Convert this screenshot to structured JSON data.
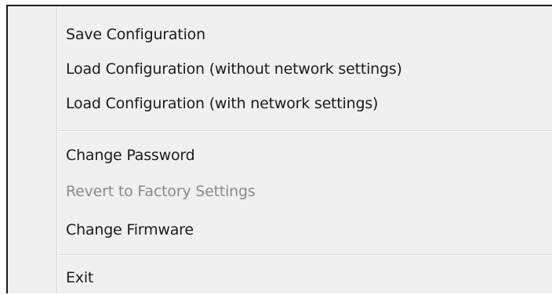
{
  "menu": {
    "items": [
      {
        "label": "Save Configuration",
        "enabled": true
      },
      {
        "label": "Load Configuration (without network settings)",
        "enabled": true
      },
      {
        "label": "Load Configuration (with network settings)",
        "enabled": true
      },
      {
        "label": "Change Password",
        "enabled": true
      },
      {
        "label": "Revert to Factory Settings",
        "enabled": false
      },
      {
        "label": "Change Firmware",
        "enabled": true
      },
      {
        "label": "Exit",
        "enabled": true
      }
    ]
  },
  "colors": {
    "menu_background": "#f0f0f0",
    "text": "#1b1b1b",
    "disabled_text": "#8a8a8a",
    "border": "#1a1a1a"
  }
}
